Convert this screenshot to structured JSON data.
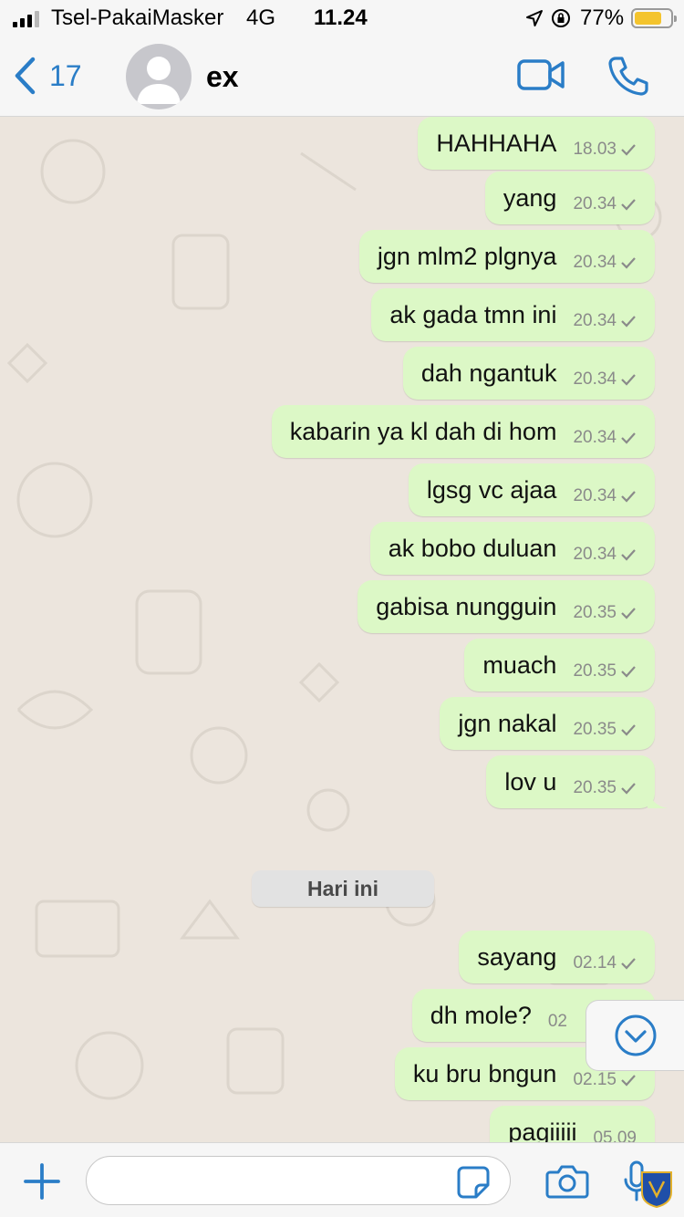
{
  "status_bar": {
    "carrier": "Tsel-PakaiMasker",
    "network": "4G",
    "time": "11.24",
    "battery_percent": "77%",
    "battery_level": 0.77
  },
  "header": {
    "back_count": "17",
    "contact_name": "ex",
    "icons": [
      "chevron-left-icon",
      "avatar-icon",
      "video-call-icon",
      "phone-icon"
    ],
    "accent_color": "#2a7dc7"
  },
  "chat": {
    "bubble_color": "#dcf8c6",
    "messages_before": [
      {
        "text": "HAHHAHA",
        "time": "18.03"
      },
      {
        "text": "yang",
        "time": "20.34"
      },
      {
        "text": "jgn mlm2 plgnya",
        "time": "20.34"
      },
      {
        "text": "ak gada tmn ini",
        "time": "20.34"
      },
      {
        "text": "dah ngantuk",
        "time": "20.34"
      },
      {
        "text": "kabarin ya kl dah di hom",
        "time": "20.34"
      },
      {
        "text": "lgsg vc ajaa",
        "time": "20.34"
      },
      {
        "text": "ak bobo duluan",
        "time": "20.34"
      },
      {
        "text": "gabisa nungguin",
        "time": "20.35"
      },
      {
        "text": "muach",
        "time": "20.35"
      },
      {
        "text": "jgn nakal",
        "time": "20.35"
      },
      {
        "text": "lov u",
        "time": "20.35"
      }
    ],
    "date_separator": "Hari ini",
    "messages_today": [
      {
        "text": "sayang",
        "time": "02.14"
      },
      {
        "text": "dh mole?",
        "time": "02"
      },
      {
        "text": "ku bru bngun",
        "time": "02.15"
      },
      {
        "text": "pagiiiii",
        "time": "05.09"
      }
    ]
  },
  "input_bar": {
    "placeholder": "",
    "icons": [
      "plus-icon",
      "sticker-icon",
      "camera-icon",
      "microphone-icon"
    ]
  }
}
